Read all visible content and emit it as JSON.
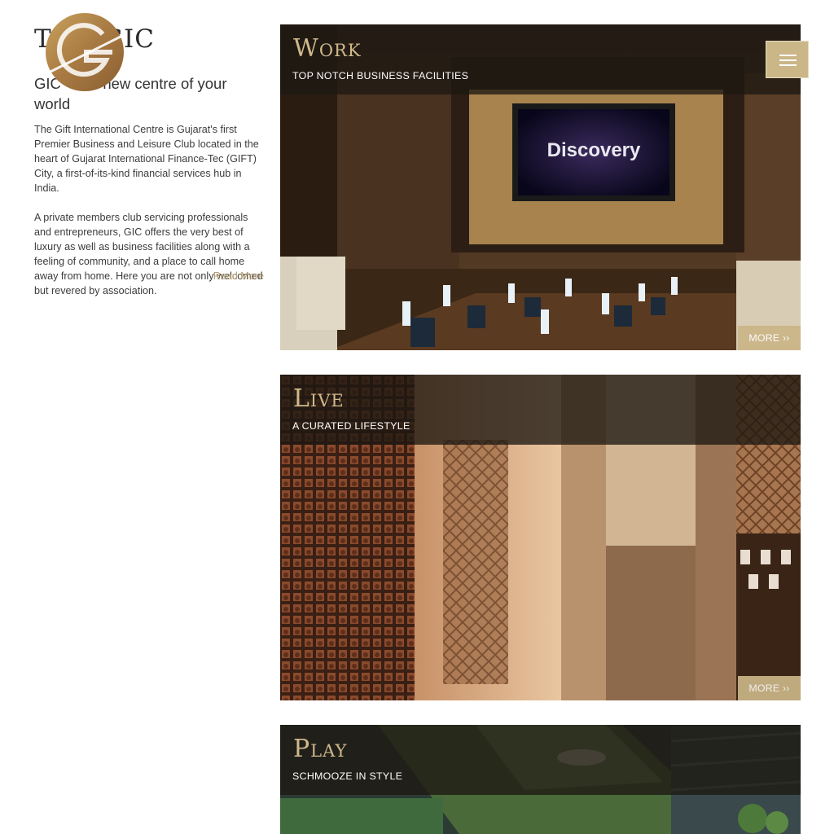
{
  "left": {
    "title": "THE GIC",
    "subtitle": "GIC – the new centre of your world",
    "paragraph1": "The Gift International Centre is Gujarat's first Premier Business and Leisure Club located in the heart of Gujarat International Finance-Tec (GIFT) City, a first-of-its-kind financial services hub in India.",
    "paragraph2": "A private members club servicing professionals and entrepreneurs, GIC offers the very best of luxury as well as business facilities along with a feeling of community, and a place to call home away from home. Here you are not only welcomed but revered by association.",
    "read_more": "Read More"
  },
  "menu": {
    "icon": "hamburger-icon"
  },
  "cards": [
    {
      "title": "Work",
      "subtitle": "TOP NOTCH BUSINESS FACILITIES",
      "more": "MORE ››",
      "screen_text": "Discovery"
    },
    {
      "title": "Live",
      "subtitle": "A CURATED LIFESTYLE",
      "more": "MORE ››"
    },
    {
      "title": "Play",
      "subtitle": "SCHMOOZE IN STYLE"
    }
  ],
  "colors": {
    "gold": "#cbb687",
    "title_gold": "#cfb98c"
  }
}
